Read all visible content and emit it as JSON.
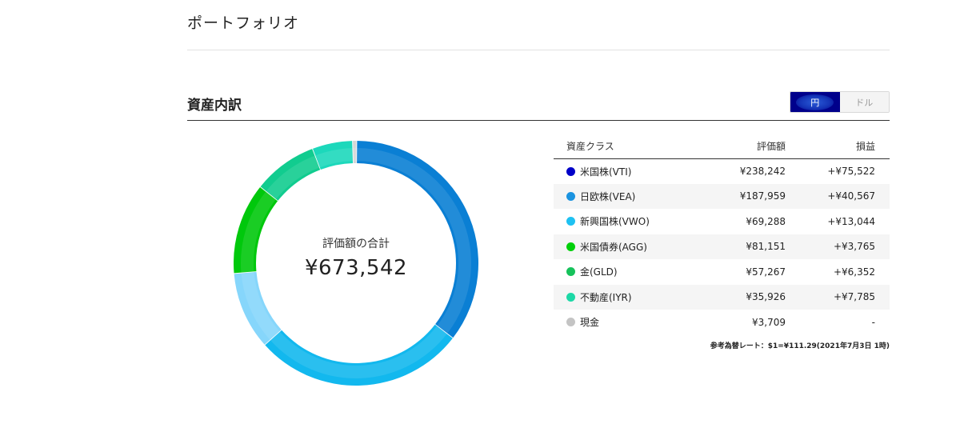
{
  "page": {
    "title": "ポートフォリオ"
  },
  "section": {
    "title": "資産内訳"
  },
  "currency_toggle": {
    "yen_label": "円",
    "dollar_label": "ドル",
    "selected": "円"
  },
  "summary": {
    "total_label": "評価額の合計",
    "total_value": "¥673,542",
    "total_yen": 673542
  },
  "table": {
    "headers": {
      "asset_class": "資産クラス",
      "value": "評価額",
      "pl": "損益"
    },
    "rows": [
      {
        "name": "米国株(VTI)",
        "value": "¥238,242",
        "pl": "+¥75,522",
        "amount": 238242,
        "color": "#0000c8"
      },
      {
        "name": "日欧株(VEA)",
        "value": "¥187,959",
        "pl": "+¥40,567",
        "amount": 187959,
        "color": "#1a93e0"
      },
      {
        "name": "新興国株(VWO)",
        "value": "¥69,288",
        "pl": "+¥13,044",
        "amount": 69288,
        "color": "#1ec1f2"
      },
      {
        "name": "米国債券(AGG)",
        "value": "¥81,151",
        "pl": "+¥3,765",
        "amount": 81151,
        "color": "#00d00a"
      },
      {
        "name": "金(GLD)",
        "value": "¥57,267",
        "pl": "+¥6,352",
        "amount": 57267,
        "color": "#16c25b"
      },
      {
        "name": "不動産(IYR)",
        "value": "¥35,926",
        "pl": "+¥7,785",
        "amount": 35926,
        "color": "#1cd8a6"
      },
      {
        "name": "現金",
        "value": "¥3,709",
        "pl": "-",
        "amount": 3709,
        "color": "#c4c4c4"
      }
    ]
  },
  "donut_colors": [
    "#0a7fd4",
    "#12b8ee",
    "#86d6fb",
    "#00c80c",
    "#11cc8f",
    "#1cd8bb",
    "#d6d6d6"
  ],
  "rate_note": "参考為替レート：$1=¥111.29(2021年7月3日 1時)"
}
